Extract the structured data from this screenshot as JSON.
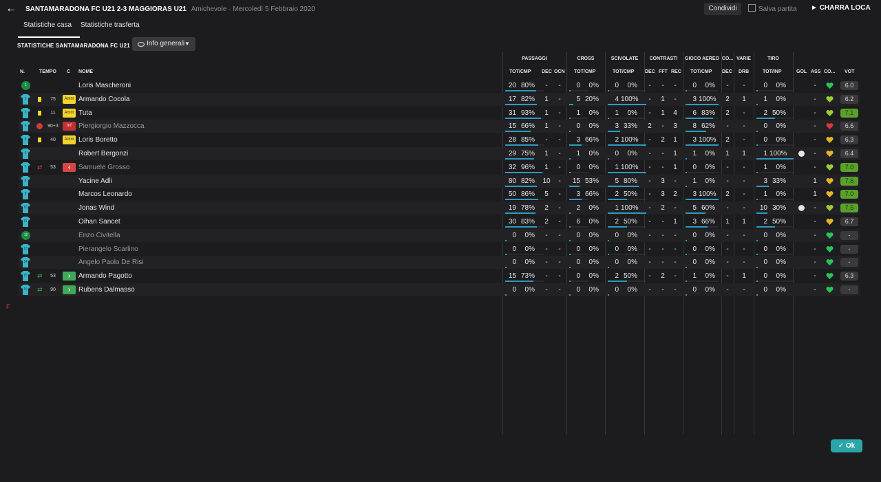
{
  "header": {
    "title": "SANTAMARADONA FC U21 2-3 MAGGIORAS U21",
    "subtitle": "Amichevole · Mercoledì 5 Febbraio 2020",
    "share_label": "Condividi",
    "save_label": "Salva partita",
    "continue_label": "CHARRA LOCA"
  },
  "tabs": [
    {
      "label": "Statistiche casa",
      "active": true
    },
    {
      "label": "Statistiche trasferta",
      "active": false
    }
  ],
  "section_title": "STATISTICHE SANTAMARADONA FC U21",
  "view_select": {
    "value": "Info generali"
  },
  "columns": {
    "n": "N.",
    "time": "TEMPO",
    "c": "C",
    "name": "NOME",
    "groups": [
      "PASSAGGI",
      "CROSS",
      "SCIVOLATE",
      "CONTRASTI",
      "GIOCO AEREO",
      "CO...",
      "VARIE",
      "TIRO"
    ],
    "sub": {
      "pass_tot": "TOT/CMP",
      "pass_dec": "DEC",
      "pass_ocn": "OCN",
      "cross_tot": "TOT/CMP",
      "tack_tot": "TOT/CMP",
      "con_dec": "DEC",
      "con_fft": "FFT",
      "con_rec": "REC",
      "air_tot": "TOT/CMP",
      "co_dec": "DEC",
      "varie_drb": "DRB",
      "shot_tot": "TOT/INP",
      "gol": "GOL",
      "ass": "ASS",
      "co": "CO...",
      "vot": "VOT"
    }
  },
  "colors": {
    "accent": "#2e9ac4",
    "yellow_card": "#f5d42b",
    "red": "#c43030",
    "good_rating": "#5aa02c",
    "ok_button": "#2aa6a8"
  },
  "players": [
    {
      "n": "1",
      "kit": "gk",
      "card": "",
      "minute": "",
      "tag": "",
      "name": "Loris Mascheroni",
      "dim": false,
      "pass": [
        "20",
        "80%"
      ],
      "pass_pct": 80,
      "pdec": "-",
      "pocn": "-",
      "cross": [
        "0",
        "0%"
      ],
      "cross_pct": 0,
      "tack": [
        "0",
        "0%"
      ],
      "tack_pct": 0,
      "cdec": "-",
      "cfft": "-",
      "crec": "-",
      "air": [
        "0",
        "0%"
      ],
      "air_pct": 0,
      "codec": "-",
      "drb": "-",
      "shot": [
        "0",
        "0%"
      ],
      "shot_pct": 0,
      "gol": "",
      "ass": "-",
      "mood": "green",
      "vot": "6.0",
      "vot_good": false
    },
    {
      "n": "2",
      "kit": "field",
      "card": "yellow",
      "minute": "75",
      "tag": "Amm",
      "name": "Armando Cocola",
      "dim": false,
      "pass": [
        "17",
        "82%"
      ],
      "pass_pct": 82,
      "pdec": "1",
      "pocn": "-",
      "cross": [
        "5",
        "20%"
      ],
      "cross_pct": 20,
      "tack": [
        "4",
        "100%"
      ],
      "tack_pct": 100,
      "cdec": "-",
      "cfft": "1",
      "crec": "-",
      "air": [
        "3",
        "100%"
      ],
      "air_pct": 100,
      "codec": "2",
      "drb": "1",
      "shot": [
        "1",
        "0%"
      ],
      "shot_pct": 0,
      "gol": "",
      "ass": "-",
      "mood": "lime",
      "vot": "6.2",
      "vot_good": false
    },
    {
      "n": "3",
      "kit": "field",
      "card": "yellow",
      "minute": "11",
      "tag": "Amm",
      "name": "Tuta",
      "dim": false,
      "pass": [
        "31",
        "93%"
      ],
      "pass_pct": 93,
      "pdec": "1",
      "pocn": "-",
      "cross": [
        "1",
        "0%"
      ],
      "cross_pct": 0,
      "tack": [
        "1",
        "0%"
      ],
      "tack_pct": 0,
      "cdec": "-",
      "cfft": "1",
      "crec": "4",
      "air": [
        "6",
        "83%"
      ],
      "air_pct": 83,
      "codec": "2",
      "drb": "-",
      "shot": [
        "2",
        "50%"
      ],
      "shot_pct": 50,
      "gol": "",
      "ass": "-",
      "mood": "lime",
      "vot": "7.1",
      "vot_good": true
    },
    {
      "n": "4",
      "kit": "field",
      "card": "red",
      "minute": "90+3",
      "tag": "Inf",
      "name": "Piergiorgio Mazzocca",
      "dim": true,
      "pass": [
        "15",
        "66%"
      ],
      "pass_pct": 66,
      "pdec": "1",
      "pocn": "-",
      "cross": [
        "0",
        "0%"
      ],
      "cross_pct": 0,
      "tack": [
        "3",
        "33%"
      ],
      "tack_pct": 33,
      "cdec": "2",
      "cfft": "-",
      "crec": "3",
      "air": [
        "8",
        "62%"
      ],
      "air_pct": 62,
      "codec": "-",
      "drb": "-",
      "shot": [
        "0",
        "0%"
      ],
      "shot_pct": 0,
      "gol": "",
      "ass": "-",
      "mood": "red",
      "vot": "6.6",
      "vot_good": false
    },
    {
      "n": "5",
      "kit": "field",
      "card": "yellow",
      "minute": "40",
      "tag": "Amm",
      "name": "Loris Boretto",
      "dim": false,
      "pass": [
        "28",
        "85%"
      ],
      "pass_pct": 85,
      "pdec": "-",
      "pocn": "-",
      "cross": [
        "3",
        "66%"
      ],
      "cross_pct": 66,
      "tack": [
        "2",
        "100%"
      ],
      "tack_pct": 100,
      "cdec": "-",
      "cfft": "2",
      "crec": "1",
      "air": [
        "3",
        "100%"
      ],
      "air_pct": 100,
      "codec": "2",
      "drb": "-",
      "shot": [
        "0",
        "0%"
      ],
      "shot_pct": 0,
      "gol": "",
      "ass": "-",
      "mood": "yellow",
      "vot": "6.3",
      "vot_good": false
    },
    {
      "n": "6",
      "kit": "field",
      "card": "",
      "minute": "",
      "tag": "",
      "name": "Robert Bergonzi",
      "dim": false,
      "pass": [
        "29",
        "75%"
      ],
      "pass_pct": 75,
      "pdec": "1",
      "pocn": "-",
      "cross": [
        "1",
        "0%"
      ],
      "cross_pct": 0,
      "tack": [
        "0",
        "0%"
      ],
      "tack_pct": 0,
      "cdec": "-",
      "cfft": "-",
      "crec": "1",
      "air": [
        "1",
        "0%"
      ],
      "air_pct": 0,
      "codec": "1",
      "drb": "1",
      "shot": [
        "1",
        "100%"
      ],
      "shot_pct": 100,
      "gol": "ball",
      "ass": "-",
      "mood": "yellow",
      "vot": "6.4",
      "vot_good": false
    },
    {
      "n": "7",
      "kit": "field",
      "card": "sub_off",
      "minute": "53",
      "tag": "out",
      "name": "Samuele Grosso",
      "dim": true,
      "pass": [
        "32",
        "96%"
      ],
      "pass_pct": 96,
      "pdec": "1",
      "pocn": "-",
      "cross": [
        "0",
        "0%"
      ],
      "cross_pct": 0,
      "tack": [
        "1",
        "100%"
      ],
      "tack_pct": 100,
      "cdec": "-",
      "cfft": "-",
      "crec": "1",
      "air": [
        "0",
        "0%"
      ],
      "air_pct": 0,
      "codec": "-",
      "drb": "-",
      "shot": [
        "1",
        "0%"
      ],
      "shot_pct": 0,
      "gol": "",
      "ass": "-",
      "mood": "lime",
      "vot": "7.0",
      "vot_good": true
    },
    {
      "n": "8",
      "kit": "field",
      "card": "",
      "minute": "",
      "tag": "",
      "name": "Yacine Adli",
      "dim": false,
      "pass": [
        "80",
        "82%"
      ],
      "pass_pct": 82,
      "pdec": "10",
      "pocn": "-",
      "cross": [
        "15",
        "53%"
      ],
      "cross_pct": 53,
      "tack": [
        "5",
        "80%"
      ],
      "tack_pct": 80,
      "cdec": "-",
      "cfft": "3",
      "crec": "-",
      "air": [
        "1",
        "0%"
      ],
      "air_pct": 0,
      "codec": "-",
      "drb": "-",
      "shot": [
        "3",
        "33%"
      ],
      "shot_pct": 33,
      "gol": "",
      "ass": "1",
      "mood": "yellow",
      "vot": "7.6",
      "vot_good": true
    },
    {
      "n": "9",
      "kit": "field",
      "card": "",
      "minute": "",
      "tag": "",
      "name": "Marcos Leonardo",
      "dim": false,
      "pass": [
        "50",
        "86%"
      ],
      "pass_pct": 86,
      "pdec": "5",
      "pocn": "-",
      "cross": [
        "3",
        "66%"
      ],
      "cross_pct": 66,
      "tack": [
        "2",
        "50%"
      ],
      "tack_pct": 50,
      "cdec": "-",
      "cfft": "3",
      "crec": "2",
      "air": [
        "3",
        "100%"
      ],
      "air_pct": 100,
      "codec": "2",
      "drb": "-",
      "shot": [
        "1",
        "0%"
      ],
      "shot_pct": 0,
      "gol": "",
      "ass": "1",
      "mood": "yellow",
      "vot": "7.0",
      "vot_good": true
    },
    {
      "n": "10",
      "kit": "field",
      "card": "",
      "minute": "",
      "tag": "",
      "name": "Jonas Wind",
      "dim": false,
      "pass": [
        "19",
        "78%"
      ],
      "pass_pct": 78,
      "pdec": "2",
      "pocn": "-",
      "cross": [
        "2",
        "0%"
      ],
      "cross_pct": 0,
      "tack": [
        "1",
        "100%"
      ],
      "tack_pct": 100,
      "cdec": "-",
      "cfft": "2",
      "crec": "-",
      "air": [
        "5",
        "60%"
      ],
      "air_pct": 60,
      "codec": "-",
      "drb": "-",
      "shot": [
        "10",
        "30%"
      ],
      "shot_pct": 30,
      "gol": "ball",
      "ass": "-",
      "mood": "lime",
      "vot": "7.5",
      "vot_good": true
    },
    {
      "n": "11",
      "kit": "field",
      "card": "",
      "minute": "",
      "tag": "",
      "name": "Oihan Sancet",
      "dim": false,
      "pass": [
        "30",
        "83%"
      ],
      "pass_pct": 83,
      "pdec": "2",
      "pocn": "-",
      "cross": [
        "6",
        "0%"
      ],
      "cross_pct": 0,
      "tack": [
        "2",
        "50%"
      ],
      "tack_pct": 50,
      "cdec": "-",
      "cfft": "-",
      "crec": "1",
      "air": [
        "3",
        "66%"
      ],
      "air_pct": 66,
      "codec": "1",
      "drb": "1",
      "shot": [
        "2",
        "50%"
      ],
      "shot_pct": 50,
      "gol": "",
      "ass": "-",
      "mood": "yellow",
      "vot": "6.7",
      "vot_good": false
    },
    {
      "n": "12",
      "kit": "gk",
      "card": "",
      "minute": "",
      "tag": "",
      "name": "Enzo Civitella",
      "dim": true,
      "pass": [
        "0",
        "0%"
      ],
      "pass_pct": 0,
      "pdec": "-",
      "pocn": "-",
      "cross": [
        "0",
        "0%"
      ],
      "cross_pct": 0,
      "tack": [
        "0",
        "0%"
      ],
      "tack_pct": 0,
      "cdec": "-",
      "cfft": "-",
      "crec": "-",
      "air": [
        "0",
        "0%"
      ],
      "air_pct": 0,
      "codec": "-",
      "drb": "-",
      "shot": [
        "0",
        "0%"
      ],
      "shot_pct": 0,
      "gol": "",
      "ass": "-",
      "mood": "green",
      "vot": "-",
      "vot_good": false
    },
    {
      "n": "13",
      "kit": "field",
      "card": "",
      "minute": "",
      "tag": "",
      "name": "Pierangelo Scarlino",
      "dim": true,
      "pass": [
        "0",
        "0%"
      ],
      "pass_pct": 0,
      "pdec": "-",
      "pocn": "-",
      "cross": [
        "0",
        "0%"
      ],
      "cross_pct": 0,
      "tack": [
        "0",
        "0%"
      ],
      "tack_pct": 0,
      "cdec": "-",
      "cfft": "-",
      "crec": "-",
      "air": [
        "0",
        "0%"
      ],
      "air_pct": 0,
      "codec": "-",
      "drb": "-",
      "shot": [
        "0",
        "0%"
      ],
      "shot_pct": 0,
      "gol": "",
      "ass": "-",
      "mood": "green",
      "vot": "-",
      "vot_good": false
    },
    {
      "n": "14",
      "kit": "field",
      "card": "",
      "minute": "",
      "tag": "",
      "name": "Angelo Paolo De Risi",
      "dim": true,
      "pass": [
        "0",
        "0%"
      ],
      "pass_pct": 0,
      "pdec": "-",
      "pocn": "-",
      "cross": [
        "0",
        "0%"
      ],
      "cross_pct": 0,
      "tack": [
        "0",
        "0%"
      ],
      "tack_pct": 0,
      "cdec": "-",
      "cfft": "-",
      "crec": "-",
      "air": [
        "0",
        "0%"
      ],
      "air_pct": 0,
      "codec": "-",
      "drb": "-",
      "shot": [
        "0",
        "0%"
      ],
      "shot_pct": 0,
      "gol": "",
      "ass": "-",
      "mood": "green",
      "vot": "-",
      "vot_good": false
    },
    {
      "n": "15",
      "kit": "field",
      "card": "sub_on",
      "minute": "53",
      "tag": "in",
      "name": "Armando Pagotto",
      "dim": false,
      "pass": [
        "15",
        "73%"
      ],
      "pass_pct": 73,
      "pdec": "-",
      "pocn": "-",
      "cross": [
        "0",
        "0%"
      ],
      "cross_pct": 0,
      "tack": [
        "2",
        "50%"
      ],
      "tack_pct": 50,
      "cdec": "-",
      "cfft": "2",
      "crec": "-",
      "air": [
        "1",
        "0%"
      ],
      "air_pct": 0,
      "codec": "-",
      "drb": "1",
      "shot": [
        "0",
        "0%"
      ],
      "shot_pct": 0,
      "gol": "",
      "ass": "-",
      "mood": "green",
      "vot": "6.3",
      "vot_good": false
    },
    {
      "n": "16",
      "kit": "field",
      "card": "sub_on",
      "minute": "90",
      "tag": "in",
      "name": "Rubens Dalmasso",
      "dim": false,
      "pass": [
        "0",
        "0%"
      ],
      "pass_pct": 0,
      "pdec": "-",
      "pocn": "-",
      "cross": [
        "0",
        "0%"
      ],
      "cross_pct": 0,
      "tack": [
        "0",
        "0%"
      ],
      "tack_pct": 0,
      "cdec": "-",
      "cfft": "-",
      "crec": "-",
      "air": [
        "0",
        "0%"
      ],
      "air_pct": 0,
      "codec": "-",
      "drb": "-",
      "shot": [
        "0",
        "0%"
      ],
      "shot_pct": 0,
      "gol": "",
      "ass": "-",
      "mood": "green",
      "vot": "-",
      "vot_good": false
    }
  ],
  "ok_label": "Ok",
  "side_marker": "F"
}
